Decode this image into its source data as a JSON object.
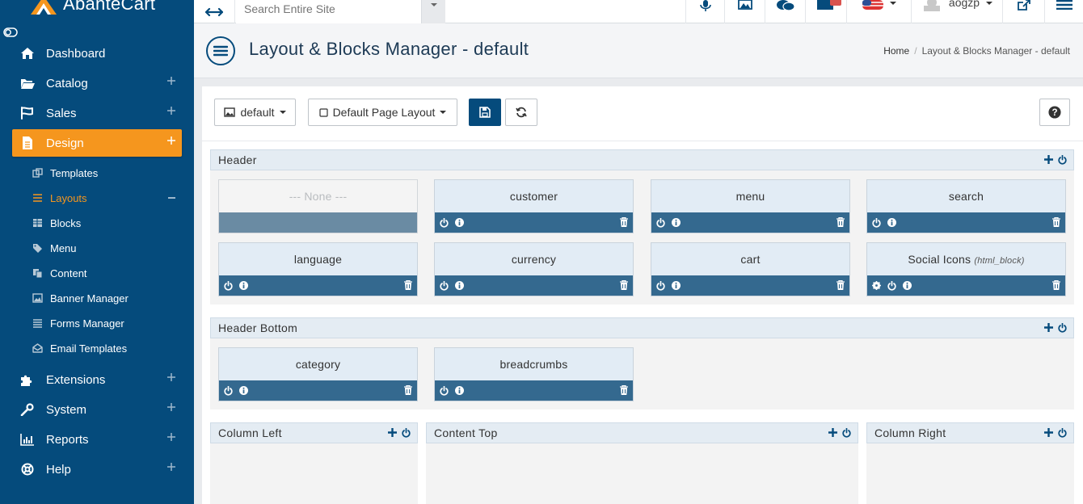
{
  "app": {
    "logo_text": "AbanteCart"
  },
  "topbar": {
    "search_placeholder": "Search Entire Site",
    "user_name": "aogzp"
  },
  "sidebar": {
    "items": [
      {
        "label": "Dashboard",
        "icon": "home-icon"
      },
      {
        "label": "Catalog",
        "icon": "folder-open-icon"
      },
      {
        "label": "Sales",
        "icon": "flag-icon"
      },
      {
        "label": "Design",
        "icon": "file-icon",
        "active": true
      },
      {
        "label": "Extensions",
        "icon": "puzzle-icon"
      },
      {
        "label": "System",
        "icon": "wrench-icon"
      },
      {
        "label": "Reports",
        "icon": "bar-chart-icon"
      },
      {
        "label": "Help",
        "icon": "life-ring-icon"
      }
    ],
    "design_subitems": [
      {
        "label": "Templates",
        "icon": "templates-icon"
      },
      {
        "label": "Layouts",
        "icon": "list-icon",
        "active": true
      },
      {
        "label": "Blocks",
        "icon": "blocks-icon"
      },
      {
        "label": "Menu",
        "icon": "tag-icon"
      },
      {
        "label": "Content",
        "icon": "copy-icon"
      },
      {
        "label": "Banner Manager",
        "icon": "image-icon"
      },
      {
        "label": "Forms Manager",
        "icon": "list-alt-icon"
      },
      {
        "label": "Email Templates",
        "icon": "envelope-open-icon"
      }
    ]
  },
  "page": {
    "title": "Layout & Blocks Manager - default",
    "breadcrumb": [
      "Home",
      "Layout & Blocks Manager - default"
    ]
  },
  "toolbar": {
    "template_select": "default",
    "layout_select": "Default Page Layout"
  },
  "sections": {
    "header": {
      "title": "Header",
      "blocks": [
        {
          "name": "--- None ---",
          "empty": true
        },
        {
          "name": "customer"
        },
        {
          "name": "menu"
        },
        {
          "name": "search"
        },
        {
          "name": "language"
        },
        {
          "name": "currency"
        },
        {
          "name": "cart"
        },
        {
          "name": "Social Icons",
          "type": "(html_block)"
        }
      ]
    },
    "header_bottom": {
      "title": "Header Bottom",
      "blocks": [
        {
          "name": "category"
        },
        {
          "name": "breadcrumbs"
        }
      ]
    },
    "column_left": {
      "title": "Column Left"
    },
    "content_top": {
      "title": "Content Top"
    },
    "column_right": {
      "title": "Column Right"
    }
  },
  "colors": {
    "sidebar": "#054b7c",
    "accent": "#f5961e",
    "block_bar": "#34698f",
    "block_bg": "#e2ecf5"
  }
}
